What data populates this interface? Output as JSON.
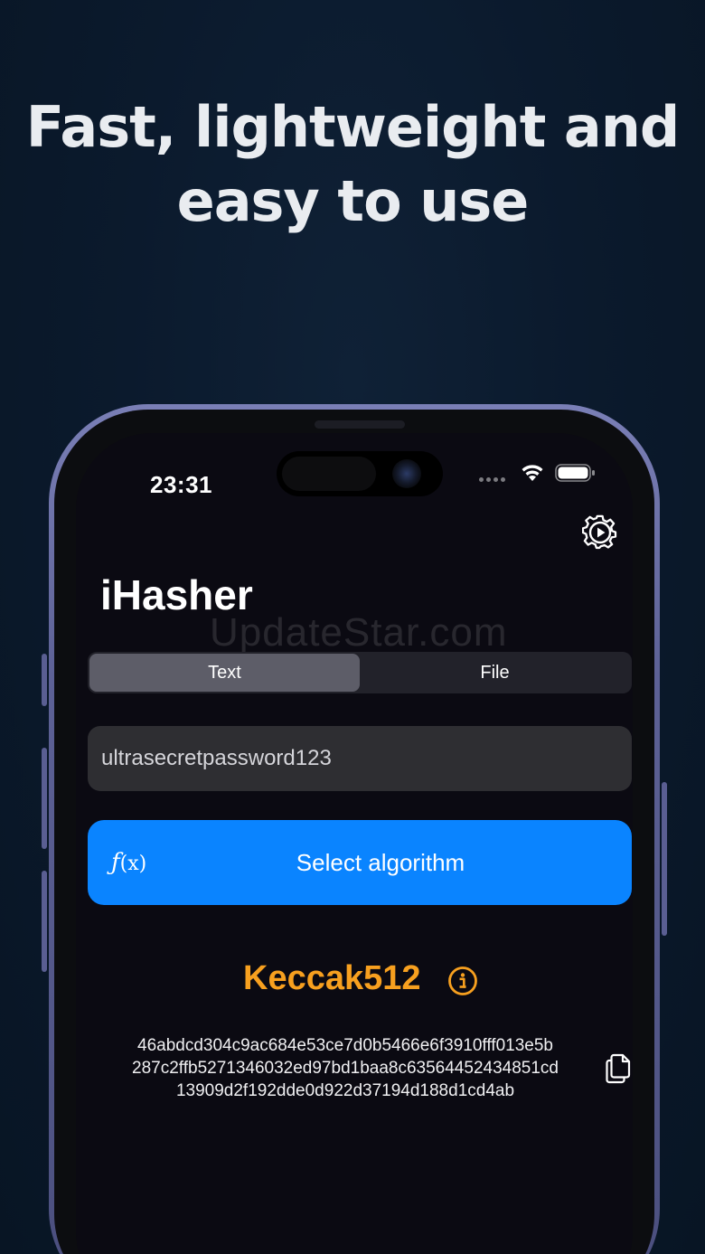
{
  "headline": {
    "line1": "Fast, lightweight and",
    "line2": "easy to use"
  },
  "status_bar": {
    "time": "23:31",
    "wifi_icon": "wifi-icon",
    "battery_icon": "battery-icon"
  },
  "app": {
    "title": "iHasher",
    "settings_icon": "gear-play-icon",
    "watermark": "UpdateStar.com",
    "segments": [
      {
        "label": "Text",
        "selected": true
      },
      {
        "label": "File",
        "selected": false
      }
    ],
    "input_value": "ultrasecretpassword123",
    "algo_button": {
      "icon": "f(x)-icon",
      "icon_f": "ƒ",
      "icon_x": "(x)",
      "label": "Select algorithm"
    },
    "algorithm_name": "Keccak512",
    "hash_lines": [
      "46abdcd304c9ac684e53ce7d0b5466e6f3910fff013e5b",
      "287c2ffb5271346032ed97bd1baa8c63564452434851cd",
      "13909d2f192dde0d922d37194d188d1cd4ab"
    ]
  },
  "colors": {
    "background": "#0b1a2d",
    "accent_blue": "#0a84ff",
    "algorithm_orange": "#f7a01f",
    "phone_frame": "#5d6196"
  }
}
